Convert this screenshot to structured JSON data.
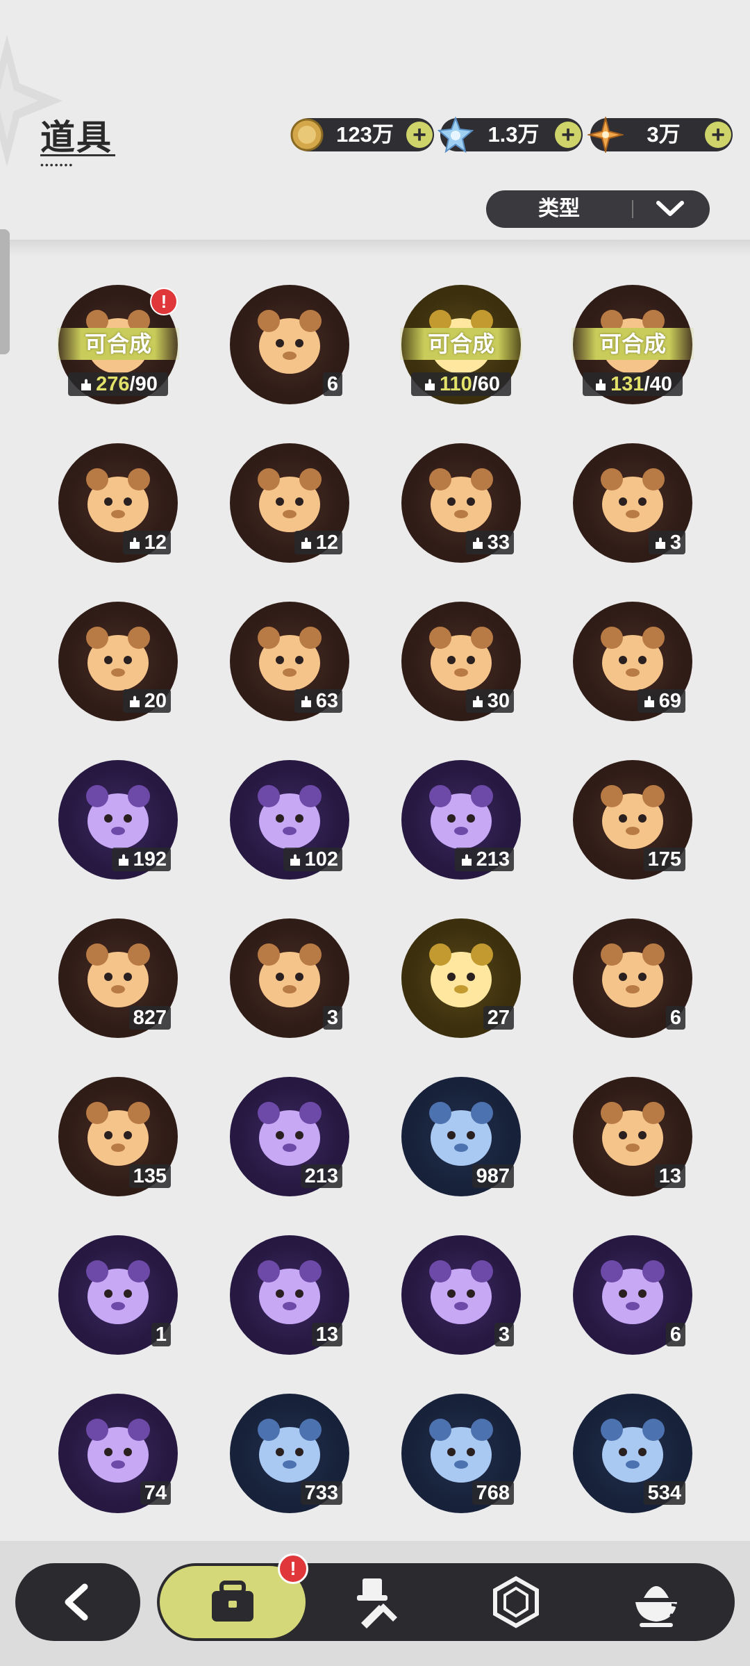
{
  "header": {
    "title": "道具",
    "title_dots": "•••••••"
  },
  "currencies": [
    {
      "id": "gold",
      "icon": "gold-coin-icon",
      "value": "123万",
      "plus": "+"
    },
    {
      "id": "crystal",
      "icon": "blue-crystal-icon",
      "value": "1.3万",
      "plus": "+"
    },
    {
      "id": "star",
      "icon": "orange-star-gem-icon",
      "value": "3万",
      "plus": "+"
    }
  ],
  "filter": {
    "label": "类型"
  },
  "colors": {
    "orange": "#e0893e",
    "purple": "#8a5ce0",
    "gold": "#e8c948",
    "blue": "#5b8fe0",
    "accent": "#d5d878",
    "alert": "#e0373a"
  },
  "items": [
    {
      "icon": "bear-fragment-icon",
      "rarity": "orange",
      "craft_label": "可合成",
      "have": "276",
      "need": "/90",
      "alert": "!"
    },
    {
      "icon": "purple-crystal-shard-icon",
      "rarity": "orange",
      "count": "6"
    },
    {
      "icon": "bear-fragment-icon",
      "rarity": "gold",
      "craft_label": "可合成",
      "have": "110",
      "need": "/60"
    },
    {
      "icon": "bear-fragment-icon",
      "rarity": "orange",
      "craft_label": "可合成",
      "have": "131",
      "need": "/40"
    },
    {
      "icon": "teal-chick-plush-icon",
      "rarity": "orange",
      "count": "12"
    },
    {
      "icon": "cat-plush-icon",
      "rarity": "orange",
      "count": "12"
    },
    {
      "icon": "teddy-bear-icon",
      "rarity": "orange",
      "count": "33"
    },
    {
      "icon": "knight-bear-icon",
      "rarity": "orange",
      "count": "3"
    },
    {
      "icon": "white-bear-icon",
      "rarity": "orange",
      "count": "20"
    },
    {
      "icon": "white-tiger-plush-icon",
      "rarity": "orange",
      "count": "63"
    },
    {
      "icon": "dark-bear-icon",
      "rarity": "orange",
      "count": "30"
    },
    {
      "icon": "purple-cat-plush-icon",
      "rarity": "orange",
      "count": "69"
    },
    {
      "icon": "bunny-plush-icon",
      "rarity": "purple",
      "count": "192"
    },
    {
      "icon": "brown-bear-plush-icon",
      "rarity": "purple",
      "count": "102"
    },
    {
      "icon": "yellow-chick-plush-icon",
      "rarity": "purple",
      "count": "213"
    },
    {
      "icon": "pink-star-crystal-icon",
      "rarity": "orange",
      "count": "175"
    },
    {
      "icon": "blue-star-crystal-icon",
      "rarity": "orange",
      "count": "827"
    },
    {
      "icon": "paw-charm-icon",
      "rarity": "orange",
      "count": "3"
    },
    {
      "icon": "golden-card-icon",
      "rarity": "gold",
      "count": "27"
    },
    {
      "icon": "rainbow-card-icon",
      "rarity": "orange",
      "count": "6"
    },
    {
      "icon": "orange-card-icon",
      "rarity": "orange",
      "count": "135"
    },
    {
      "icon": "purple-card-icon",
      "rarity": "purple",
      "count": "213"
    },
    {
      "icon": "blue-card-icon",
      "rarity": "blue",
      "count": "987"
    },
    {
      "icon": "clover-card-icon",
      "rarity": "orange",
      "count": "13"
    },
    {
      "icon": "gift-box-icon",
      "rarity": "purple",
      "count": "1"
    },
    {
      "icon": "golden-bell-icon",
      "rarity": "purple",
      "count": "13"
    },
    {
      "icon": "magic-mirror-icon",
      "rarity": "purple",
      "count": "3"
    },
    {
      "icon": "scroll-icon",
      "rarity": "purple",
      "count": "6"
    },
    {
      "icon": "peach-fruit-icon",
      "rarity": "purple",
      "count": "74"
    },
    {
      "icon": "shovel-icon",
      "rarity": "blue",
      "count": "733"
    },
    {
      "icon": "boxing-glove-icon",
      "rarity": "blue",
      "count": "768"
    },
    {
      "icon": "pickaxe-icon",
      "rarity": "blue",
      "count": "534"
    }
  ],
  "nav": {
    "back": {
      "icon": "back-arrow-icon"
    },
    "tabs": [
      {
        "icon": "briefcase-icon",
        "active": true,
        "badge": "!"
      },
      {
        "icon": "hat-and-tools-icon",
        "active": false
      },
      {
        "icon": "hexagon-gem-icon",
        "active": false
      },
      {
        "icon": "cup-dessert-icon",
        "active": false
      }
    ]
  }
}
